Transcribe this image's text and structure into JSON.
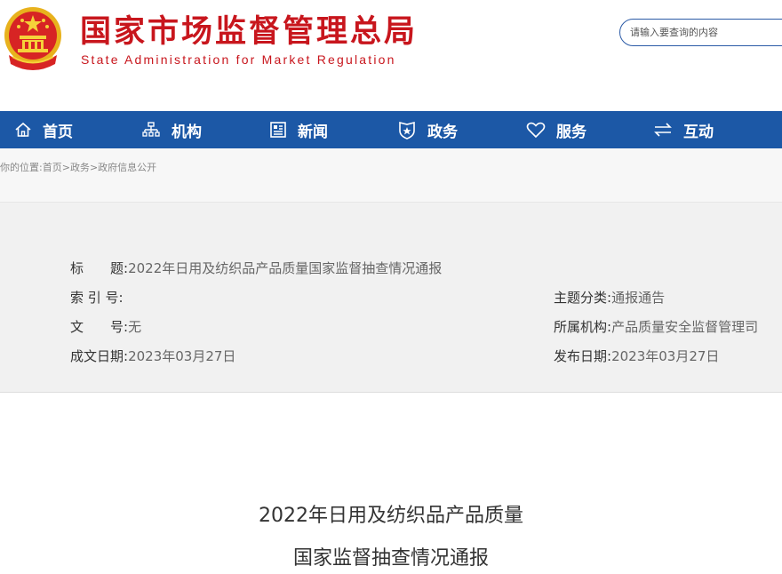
{
  "header": {
    "title_cn": "国家市场监督管理总局",
    "title_en": "State Administration for Market Regulation",
    "search_placeholder": "请输入要查询的内容"
  },
  "nav": {
    "items": [
      {
        "label": "首页",
        "icon": "home-icon"
      },
      {
        "label": "机构",
        "icon": "org-chart-icon"
      },
      {
        "label": "新闻",
        "icon": "newspaper-icon"
      },
      {
        "label": "政务",
        "icon": "shield-star-icon"
      },
      {
        "label": "服务",
        "icon": "heart-icon"
      },
      {
        "label": "互动",
        "icon": "swap-arrows-icon"
      }
    ]
  },
  "breadcrumb": {
    "prefix": "你的位置:",
    "items": [
      "首页",
      "政务",
      "政府信息公开"
    ],
    "separator": ">"
  },
  "meta": {
    "title_label": "标　　题:",
    "title_value": "2022年日用及纺织品产品质量国家监督抽查情况通报",
    "index_label": "索 引 号:",
    "index_value": "",
    "topic_label": "主题分类:",
    "topic_value": "通报通告",
    "docno_label": "文　　号:",
    "docno_value": "无",
    "org_label": "所属机构:",
    "org_value": "产品质量安全监督管理司",
    "date_label": "成文日期:",
    "date_value": "2023年03月27日",
    "pub_label": "发布日期:",
    "pub_value": "2023年03月27日"
  },
  "document": {
    "title_line1": "2022年日用及纺织品产品质量",
    "title_line2": "国家监督抽查情况通报"
  },
  "colors": {
    "brand_red": "#c8161d",
    "nav_blue": "#1c58a6"
  }
}
